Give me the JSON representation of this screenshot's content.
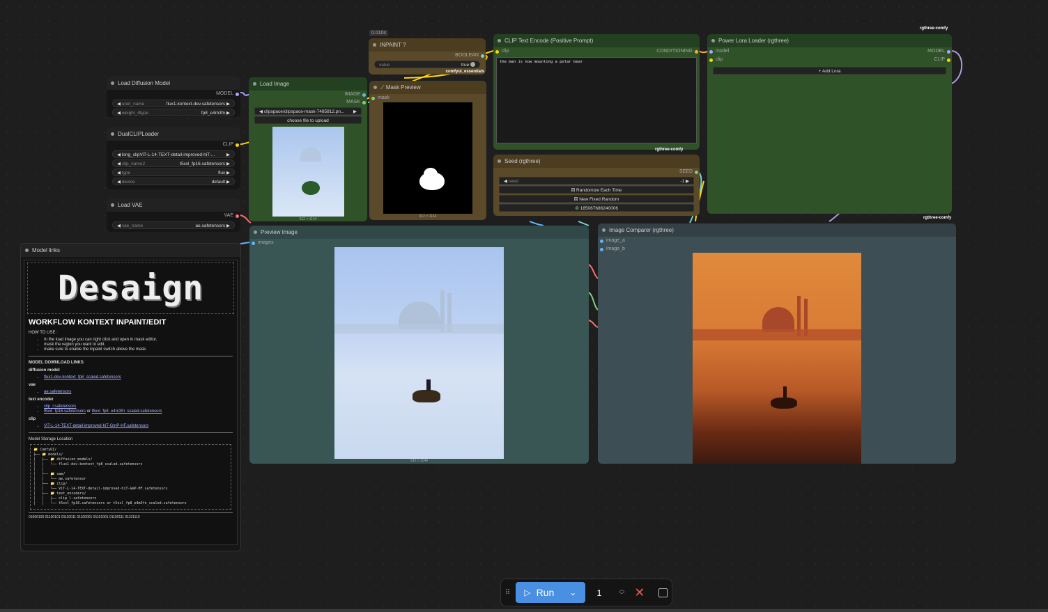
{
  "timer": "0.010s",
  "nodes": {
    "load_diffusion": {
      "title": "Load Diffusion Model",
      "out": "MODEL",
      "w1_label": "unet_name",
      "w1_value": "flux1-kontext-dev.safetensors",
      "w2_label": "weight_dtype",
      "w2_value": "fp8_e4m3fn"
    },
    "dualclip": {
      "title": "DualCLIPLoader",
      "out": "CLIP",
      "w1_value": "long_clipViT-L-14-TEXT-detail-improved-hiT-...",
      "w2_label": "clip_name2",
      "w2_value": "t5xxl_fp16.safetensors",
      "w3_label": "type",
      "w3_value": "flux",
      "w4_label": "device",
      "w4_value": "default"
    },
    "load_vae": {
      "title": "Load VAE",
      "out": "VAE",
      "w1_label": "vae_name",
      "w1_value": "ae.safetensors"
    },
    "load_image": {
      "title": "Load Image",
      "out1": "IMAGE",
      "out2": "MASK",
      "file": "clipspace/clipspace-mask-7485812.pn...",
      "upload": "choose file to upload",
      "size": "912 × 1144"
    },
    "inpaint": {
      "title": "INPAINT ?",
      "out": "BOOLEAN",
      "w_label": "value",
      "w_value": "true",
      "footer": "comfyui_essentials"
    },
    "mask_preview": {
      "title": "Mask Preview",
      "in": "mask",
      "size": "912 × 1144"
    },
    "clip_text": {
      "title": "CLIP Text Encode (Positive Prompt)",
      "in": "clip",
      "out": "CONDITIONING",
      "text": "the man is now mounting a polar bear",
      "footer": "rgthree-comfy"
    },
    "seed": {
      "title": "Seed (rgthree)",
      "out": "SEED",
      "w_label": "seed",
      "w_value": "-1",
      "b1": "Randomize Each Time",
      "b2": "New Fixed Random",
      "b3": "185067686240006"
    },
    "lora": {
      "title": "Power Lora Loader (rgthree)",
      "in1": "model",
      "in2": "clip",
      "out1": "MODEL",
      "out2": "CLIP",
      "add": "Add Lora",
      "header": "rgthree-comfy",
      "footer": "rgthree-comfy"
    },
    "preview": {
      "title": "Preview Image",
      "in": "images",
      "size": "912 × 1144"
    },
    "comparer": {
      "title": "Image Comparer (rgthree)",
      "in1": "image_a",
      "in2": "image_b"
    },
    "model_links": {
      "title": "Model links",
      "logo": "Desaign",
      "heading": "WORKFLOW KONTEXT INPAINT/EDIT",
      "how_to": "HOW TO USE :",
      "steps": [
        "In the load image you can right click and open in mask editor.",
        "mask the region you want to edit.",
        "make sure to enable the inpaint switch above the mask."
      ],
      "download_title": "MODEL DOWNLOAD LINKS",
      "diff_label": "diffusion model",
      "diff_link": "flux1-dev-kontext_fp8_scaled.safetensors",
      "vae_label": "vae",
      "vae_link": "ae.safetensors",
      "te_label": "text encoder",
      "te_link1": "clip_l.safetensors",
      "te_link2": "t5xxl_fp16.safetensors",
      "te_or": " or ",
      "te_link3": "t5xxl_fp8_e4m3fn_scaled.safetensors",
      "clip_label": "clip",
      "clip_link": "ViT-L-14-TEXT-detail-improved-hiT-GmP-HF.safetensors",
      "storage_title": "Model Storage Location",
      "tree": "📁 ComfyUI/\n├── 📁 models/\n│   ├── 📁 diffusion_models/\n│   │   └── flux1-dev-kontext_fp8_scaled.safetensors\n│   │\n│   ├── 📁 vae/\n│   │   └── ae.safetensor\n│   ├── 📁 clip/\n│   │   └── ViT-L-14-TEXT-detail-improved-hiT-GmP-HF.safetensors\n│   ├── 📁 text_encoders/\n│   │   ├── clip_l.safetensors\n│   │   └── t5xxl_fp16.safetensors or t5xxl_fp8_e4m3fn_scaled.safetensors",
      "binary": "01000100 01100101 01110011 01100001 01101001 01100111 01101110"
    }
  },
  "toolbar": {
    "run": "Run",
    "count": "1"
  }
}
